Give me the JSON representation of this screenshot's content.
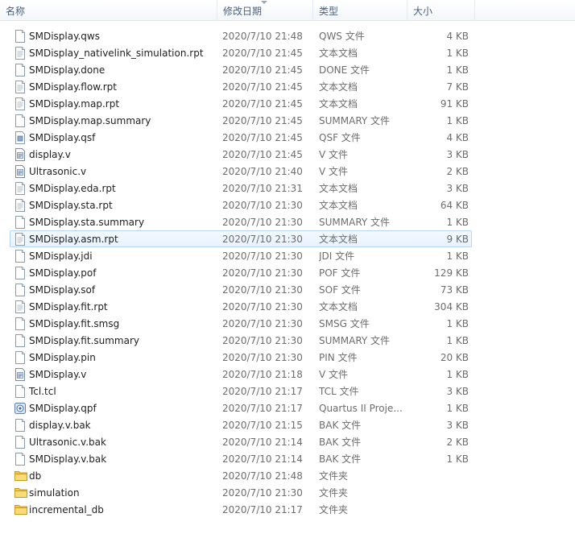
{
  "columns": {
    "name": "名称",
    "date": "修改日期",
    "type": "类型",
    "size": "大小"
  },
  "files": [
    {
      "name": "SMDisplay.qws",
      "date": "2020/7/10 21:48",
      "type": "QWS 文件",
      "size": "4 KB",
      "icon": "file-icon"
    },
    {
      "name": "SMDisplay_nativelink_simulation.rpt",
      "date": "2020/7/10 21:45",
      "type": "文本文档",
      "size": "1 KB",
      "icon": "text-document-icon"
    },
    {
      "name": "SMDisplay.done",
      "date": "2020/7/10 21:45",
      "type": "DONE 文件",
      "size": "1 KB",
      "icon": "file-icon"
    },
    {
      "name": "SMDisplay.flow.rpt",
      "date": "2020/7/10 21:45",
      "type": "文本文档",
      "size": "7 KB",
      "icon": "text-document-icon"
    },
    {
      "name": "SMDisplay.map.rpt",
      "date": "2020/7/10 21:45",
      "type": "文本文档",
      "size": "91 KB",
      "icon": "text-document-icon"
    },
    {
      "name": "SMDisplay.map.summary",
      "date": "2020/7/10 21:45",
      "type": "SUMMARY 文件",
      "size": "1 KB",
      "icon": "file-icon"
    },
    {
      "name": "SMDisplay.qsf",
      "date": "2020/7/10 21:45",
      "type": "QSF 文件",
      "size": "4 KB",
      "icon": "settings-file-icon"
    },
    {
      "name": "display.v",
      "date": "2020/7/10 21:45",
      "type": "V 文件",
      "size": "3 KB",
      "icon": "verilog-file-icon"
    },
    {
      "name": "Ultrasonic.v",
      "date": "2020/7/10 21:40",
      "type": "V 文件",
      "size": "2 KB",
      "icon": "verilog-file-icon"
    },
    {
      "name": "SMDisplay.eda.rpt",
      "date": "2020/7/10 21:31",
      "type": "文本文档",
      "size": "3 KB",
      "icon": "text-document-icon"
    },
    {
      "name": "SMDisplay.sta.rpt",
      "date": "2020/7/10 21:30",
      "type": "文本文档",
      "size": "64 KB",
      "icon": "text-document-icon"
    },
    {
      "name": "SMDisplay.sta.summary",
      "date": "2020/7/10 21:30",
      "type": "SUMMARY 文件",
      "size": "1 KB",
      "icon": "file-icon"
    },
    {
      "name": "SMDisplay.asm.rpt",
      "date": "2020/7/10 21:30",
      "type": "文本文档",
      "size": "9 KB",
      "icon": "text-document-icon"
    },
    {
      "name": "SMDisplay.jdi",
      "date": "2020/7/10 21:30",
      "type": "JDI 文件",
      "size": "1 KB",
      "icon": "file-icon"
    },
    {
      "name": "SMDisplay.pof",
      "date": "2020/7/10 21:30",
      "type": "POF 文件",
      "size": "129 KB",
      "icon": "file-icon"
    },
    {
      "name": "SMDisplay.sof",
      "date": "2020/7/10 21:30",
      "type": "SOF 文件",
      "size": "73 KB",
      "icon": "file-icon"
    },
    {
      "name": "SMDisplay.fit.rpt",
      "date": "2020/7/10 21:30",
      "type": "文本文档",
      "size": "304 KB",
      "icon": "text-document-icon"
    },
    {
      "name": "SMDisplay.fit.smsg",
      "date": "2020/7/10 21:30",
      "type": "SMSG 文件",
      "size": "1 KB",
      "icon": "file-icon"
    },
    {
      "name": "SMDisplay.fit.summary",
      "date": "2020/7/10 21:30",
      "type": "SUMMARY 文件",
      "size": "1 KB",
      "icon": "file-icon"
    },
    {
      "name": "SMDisplay.pin",
      "date": "2020/7/10 21:30",
      "type": "PIN 文件",
      "size": "20 KB",
      "icon": "file-icon"
    },
    {
      "name": "SMDisplay.v",
      "date": "2020/7/10 21:18",
      "type": "V 文件",
      "size": "1 KB",
      "icon": "verilog-file-icon"
    },
    {
      "name": "Tcl.tcl",
      "date": "2020/7/10 21:17",
      "type": "TCL 文件",
      "size": "3 KB",
      "icon": "file-icon"
    },
    {
      "name": "SMDisplay.qpf",
      "date": "2020/7/10 21:17",
      "type": "Quartus II Proje...",
      "size": "1 KB",
      "icon": "quartus-project-icon"
    },
    {
      "name": "display.v.bak",
      "date": "2020/7/10 21:15",
      "type": "BAK 文件",
      "size": "3 KB",
      "icon": "file-icon"
    },
    {
      "name": "Ultrasonic.v.bak",
      "date": "2020/7/10 21:14",
      "type": "BAK 文件",
      "size": "2 KB",
      "icon": "file-icon"
    },
    {
      "name": "SMDisplay.v.bak",
      "date": "2020/7/10 21:14",
      "type": "BAK 文件",
      "size": "1 KB",
      "icon": "file-icon"
    },
    {
      "name": "db",
      "date": "2020/7/10 21:48",
      "type": "文件夹",
      "size": "",
      "icon": "folder-icon"
    },
    {
      "name": "simulation",
      "date": "2020/7/10 21:30",
      "type": "文件夹",
      "size": "",
      "icon": "folder-icon"
    },
    {
      "name": "incremental_db",
      "date": "2020/7/10 21:17",
      "type": "文件夹",
      "size": "",
      "icon": "folder-icon"
    }
  ],
  "hovered_file": "SMDisplay.asm.rpt",
  "colors": {
    "hover_border": "#b8d6fb",
    "hover_fill": "#e8f2fe",
    "folder": "#f2c94c",
    "header_text": "#4c607a"
  }
}
